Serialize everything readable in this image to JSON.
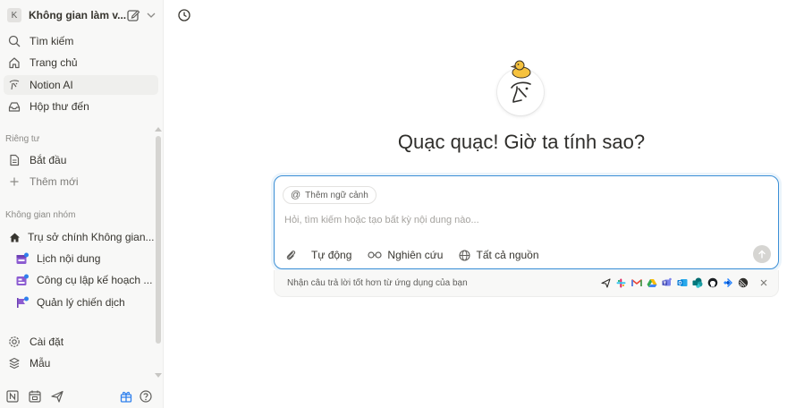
{
  "workspace": {
    "initial": "K",
    "name": "Không gian làm v..."
  },
  "nav": {
    "search": "Tìm kiếm",
    "home": "Trang chủ",
    "notion_ai": "Notion AI",
    "inbox": "Hộp thư đến"
  },
  "private": {
    "section_label": "Riêng tư",
    "items": [
      "Bắt đầu",
      "Thêm mới"
    ]
  },
  "team": {
    "section_label": "Không gian nhóm",
    "items": [
      "Trụ sở chính Không gian...",
      "Lịch nội dung",
      "Công cụ lập kế hoạch ...",
      "Quản lý chiến dịch"
    ]
  },
  "bottom_nav": {
    "settings": "Cài đặt",
    "templates": "Mẫu"
  },
  "main": {
    "headline": "Quạc quạc! Giờ ta tính sao?",
    "composer": {
      "context_chip": "Thêm ngữ cảnh",
      "placeholder": "Hỏi, tìm kiếm hoặc tạo bất kỳ nội dung nào...",
      "tools": [
        "Tự động",
        "Nghiên cứu",
        "Tất cả nguồn"
      ]
    },
    "connect_bar": {
      "text": "Nhận câu trả lời tốt hơn từ ứng dụng của bạn",
      "apps": [
        "send-app-icon",
        "slack-icon",
        "gmail-icon",
        "google-drive-icon",
        "teams-icon",
        "outlook-icon",
        "sharepoint-icon",
        "github-icon",
        "jira-icon",
        "linear-icon"
      ]
    }
  },
  "colors": {
    "accent": "#3b8fd6",
    "sidebar_bg": "#f8f8f7",
    "active_bg": "#efefed",
    "team_icon": "#8c5cd1",
    "dot_blue": "#2f80ed"
  }
}
